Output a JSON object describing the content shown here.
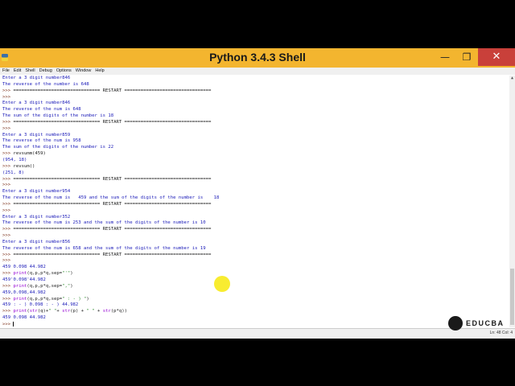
{
  "window": {
    "title": "Python 3.4.3 Shell"
  },
  "menu": [
    "File",
    "Edit",
    "Shell",
    "Debug",
    "Options",
    "Window",
    "Help"
  ],
  "shell_lines": [
    {
      "parts": [
        {
          "t": "Enter a 3 digit number846",
          "c": "out"
        }
      ]
    },
    {
      "parts": [
        {
          "t": "The reverse of the number is 648",
          "c": "out"
        }
      ]
    },
    {
      "parts": [
        {
          "t": ">>> ",
          "c": "prompt"
        },
        {
          "t": "================================ RESTART ================================",
          "c": "inp"
        }
      ]
    },
    {
      "parts": [
        {
          "t": ">>> ",
          "c": "prompt"
        }
      ]
    },
    {
      "parts": [
        {
          "t": "Enter a 3 digit number846",
          "c": "out"
        }
      ]
    },
    {
      "parts": [
        {
          "t": "The reverse of the num is 648",
          "c": "out"
        }
      ]
    },
    {
      "parts": [
        {
          "t": "The sum of the digits of the number is 18",
          "c": "out"
        }
      ]
    },
    {
      "parts": [
        {
          "t": ">>> ",
          "c": "prompt"
        },
        {
          "t": "================================ RESTART ================================",
          "c": "inp"
        }
      ]
    },
    {
      "parts": [
        {
          "t": ">>> ",
          "c": "prompt"
        }
      ]
    },
    {
      "parts": [
        {
          "t": "Enter a 3 digit number859",
          "c": "out"
        }
      ]
    },
    {
      "parts": [
        {
          "t": "The reverse of the num is 958",
          "c": "out"
        }
      ]
    },
    {
      "parts": [
        {
          "t": "The sum of the digits of the number is 22",
          "c": "out"
        }
      ]
    },
    {
      "parts": [
        {
          "t": ">>> ",
          "c": "prompt"
        },
        {
          "t": "revsumm(459)",
          "c": "inp"
        }
      ]
    },
    {
      "parts": [
        {
          "t": "(954, 18)",
          "c": "out"
        }
      ]
    },
    {
      "parts": [
        {
          "t": ">>> ",
          "c": "prompt"
        },
        {
          "t": "revsum()",
          "c": "inp"
        }
      ]
    },
    {
      "parts": [
        {
          "t": "(251, 8)",
          "c": "out"
        }
      ]
    },
    {
      "parts": [
        {
          "t": ">>> ",
          "c": "prompt"
        },
        {
          "t": "================================ RESTART ================================",
          "c": "inp"
        }
      ]
    },
    {
      "parts": [
        {
          "t": ">>> ",
          "c": "prompt"
        }
      ]
    },
    {
      "parts": [
        {
          "t": "Enter a 3 digit number954",
          "c": "out"
        }
      ]
    },
    {
      "parts": [
        {
          "t": "The reverse of the num is   459 and the sum of the digits of the number is    18",
          "c": "out"
        }
      ]
    },
    {
      "parts": [
        {
          "t": ">>> ",
          "c": "prompt"
        },
        {
          "t": "================================ RESTART ================================",
          "c": "inp"
        }
      ]
    },
    {
      "parts": [
        {
          "t": ">>> ",
          "c": "prompt"
        }
      ]
    },
    {
      "parts": [
        {
          "t": "Enter a 3 digit number352",
          "c": "out"
        }
      ]
    },
    {
      "parts": [
        {
          "t": "The reverse of the num is 253 and the sum of the digits of the number is 10",
          "c": "out"
        }
      ]
    },
    {
      "parts": [
        {
          "t": ">>> ",
          "c": "prompt"
        },
        {
          "t": "================================ RESTART ================================",
          "c": "inp"
        }
      ]
    },
    {
      "parts": [
        {
          "t": ">>> ",
          "c": "prompt"
        }
      ]
    },
    {
      "parts": [
        {
          "t": "Enter a 3 digit number856",
          "c": "out"
        }
      ]
    },
    {
      "parts": [
        {
          "t": "The reverse of the num is 658 and the sum of the digits of the number is 19",
          "c": "out"
        }
      ]
    },
    {
      "parts": [
        {
          "t": ">>> ",
          "c": "prompt"
        },
        {
          "t": "================================ RESTART ================================",
          "c": "inp"
        }
      ]
    },
    {
      "parts": [
        {
          "t": ">>> ",
          "c": "prompt"
        }
      ]
    },
    {
      "parts": [
        {
          "t": "459 0.098 44.982",
          "c": "out"
        }
      ]
    },
    {
      "parts": [
        {
          "t": ">>> ",
          "c": "prompt"
        },
        {
          "t": "print",
          "c": "kw"
        },
        {
          "t": "(q,p,p*q,sep=",
          "c": "inp"
        },
        {
          "t": "\"'\"",
          "c": "str"
        },
        {
          "t": ")",
          "c": "inp"
        }
      ]
    },
    {
      "parts": [
        {
          "t": "459'0.098'44.982",
          "c": "out"
        }
      ]
    },
    {
      "parts": [
        {
          "t": ">>> ",
          "c": "prompt"
        },
        {
          "t": "print",
          "c": "kw"
        },
        {
          "t": "(q,p,p*q,sep=",
          "c": "inp"
        },
        {
          "t": "\",\"",
          "c": "str"
        },
        {
          "t": ")",
          "c": "inp"
        }
      ]
    },
    {
      "parts": [
        {
          "t": "459,0.098,44.982",
          "c": "out"
        }
      ]
    },
    {
      "parts": [
        {
          "t": ">>> ",
          "c": "prompt"
        },
        {
          "t": "print",
          "c": "kw"
        },
        {
          "t": "(q,p,p*q,sep=",
          "c": "inp"
        },
        {
          "t": "\" : - ) \"",
          "c": "str"
        },
        {
          "t": ")",
          "c": "inp"
        }
      ]
    },
    {
      "parts": [
        {
          "t": "459 : - ) 0.098 : - ) 44.982",
          "c": "out"
        }
      ]
    },
    {
      "parts": [
        {
          "t": ">>> ",
          "c": "prompt"
        },
        {
          "t": "print",
          "c": "kw"
        },
        {
          "t": "(",
          "c": "inp"
        },
        {
          "t": "str",
          "c": "kw"
        },
        {
          "t": "(q)+",
          "c": "inp"
        },
        {
          "t": "\" \"",
          "c": "str"
        },
        {
          "t": "+ ",
          "c": "inp"
        },
        {
          "t": "str",
          "c": "kw"
        },
        {
          "t": "(p) + ",
          "c": "inp"
        },
        {
          "t": "\" \"",
          "c": "str"
        },
        {
          "t": " + ",
          "c": "inp"
        },
        {
          "t": "str",
          "c": "kw"
        },
        {
          "t": "(p*q))",
          "c": "inp"
        }
      ]
    },
    {
      "parts": [
        {
          "t": "459 0.098 44.982",
          "c": "out"
        }
      ]
    },
    {
      "parts": [
        {
          "t": ">>> ",
          "c": "prompt"
        }
      ],
      "caret": true
    }
  ],
  "status": "Ln: 48 Col: 4",
  "watermark": "EDUCBA",
  "icons": {
    "app": "python-logo-icon",
    "min": "minimize-icon",
    "max": "maximize-icon",
    "close": "close-icon"
  },
  "colors": {
    "titlebar": "#f3b52f",
    "close": "#c9403a",
    "output": "#1a1ab8",
    "prompt": "#7a2e18",
    "keyword": "#9400d3",
    "string": "#2e8b2e"
  }
}
